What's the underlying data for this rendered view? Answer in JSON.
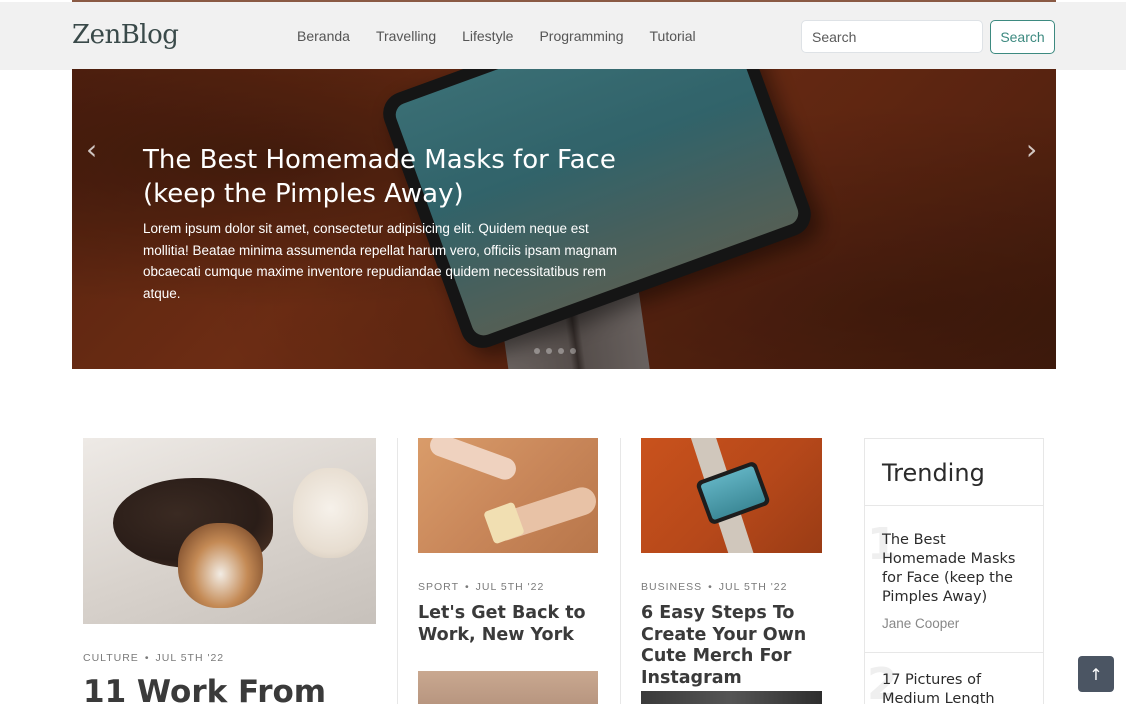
{
  "brand": {
    "name": "ZenBlog"
  },
  "nav": [
    {
      "label": "Beranda"
    },
    {
      "label": "Travelling"
    },
    {
      "label": "Lifestyle"
    },
    {
      "label": "Programming"
    },
    {
      "label": "Tutorial"
    }
  ],
  "search": {
    "placeholder": "Search",
    "button_label": "Search"
  },
  "hero": {
    "title": "The Best Homemade Masks for Face (keep the Pimples Away)",
    "text": "Lorem ipsum dolor sit amet, consectetur adipisicing elit. Quidem neque est mollitia! Beatae minima assumenda repellat harum vero, officiis ipsam magnam obcaecati cumque maxime inventore repudiandae quidem necessitatibus rem atque.",
    "prev_icon": "‹",
    "next_icon": "›"
  },
  "posts": {
    "main": {
      "category": "Culture",
      "date": "Jul 5th '22",
      "title": "11 Work From"
    },
    "sport": {
      "category": "Sport",
      "date": "Jul 5th '22",
      "title": "Let's Get Back to Work, New York"
    },
    "business": {
      "category": "Business",
      "date": "Jul 5th '22",
      "title": "6 Easy Steps To Create Your Own Cute Merch For Instagram"
    }
  },
  "trending": {
    "heading": "Trending",
    "items": [
      {
        "num": "1",
        "title": "The Best Homemade Masks for Face (keep the Pimples Away)",
        "author": "Jane Cooper"
      },
      {
        "num": "2",
        "title": "17 Pictures of Medium Length"
      }
    ]
  },
  "back_to_top": {
    "icon": "↑"
  },
  "meta_separator": "•"
}
